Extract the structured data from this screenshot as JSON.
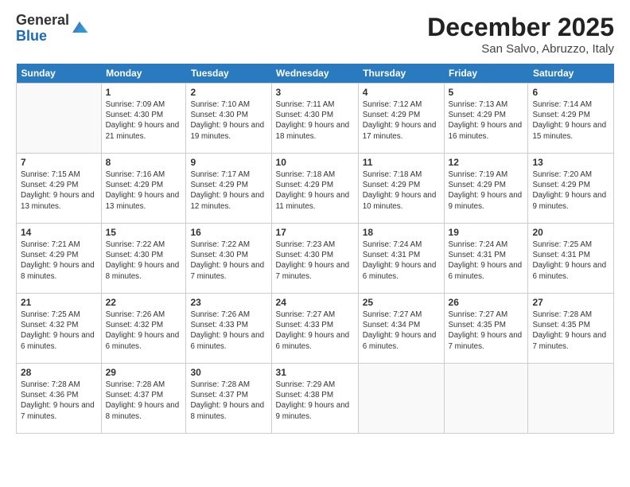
{
  "logo": {
    "line1": "General",
    "line2": "Blue"
  },
  "title": "December 2025",
  "location": "San Salvo, Abruzzo, Italy",
  "weekdays": [
    "Sunday",
    "Monday",
    "Tuesday",
    "Wednesday",
    "Thursday",
    "Friday",
    "Saturday"
  ],
  "weeks": [
    [
      {
        "day": "",
        "info": ""
      },
      {
        "day": "1",
        "info": "Sunrise: 7:09 AM\nSunset: 4:30 PM\nDaylight: 9 hours and 21 minutes."
      },
      {
        "day": "2",
        "info": "Sunrise: 7:10 AM\nSunset: 4:30 PM\nDaylight: 9 hours and 19 minutes."
      },
      {
        "day": "3",
        "info": "Sunrise: 7:11 AM\nSunset: 4:30 PM\nDaylight: 9 hours and 18 minutes."
      },
      {
        "day": "4",
        "info": "Sunrise: 7:12 AM\nSunset: 4:29 PM\nDaylight: 9 hours and 17 minutes."
      },
      {
        "day": "5",
        "info": "Sunrise: 7:13 AM\nSunset: 4:29 PM\nDaylight: 9 hours and 16 minutes."
      },
      {
        "day": "6",
        "info": "Sunrise: 7:14 AM\nSunset: 4:29 PM\nDaylight: 9 hours and 15 minutes."
      }
    ],
    [
      {
        "day": "7",
        "info": "Sunrise: 7:15 AM\nSunset: 4:29 PM\nDaylight: 9 hours and 13 minutes."
      },
      {
        "day": "8",
        "info": "Sunrise: 7:16 AM\nSunset: 4:29 PM\nDaylight: 9 hours and 13 minutes."
      },
      {
        "day": "9",
        "info": "Sunrise: 7:17 AM\nSunset: 4:29 PM\nDaylight: 9 hours and 12 minutes."
      },
      {
        "day": "10",
        "info": "Sunrise: 7:18 AM\nSunset: 4:29 PM\nDaylight: 9 hours and 11 minutes."
      },
      {
        "day": "11",
        "info": "Sunrise: 7:18 AM\nSunset: 4:29 PM\nDaylight: 9 hours and 10 minutes."
      },
      {
        "day": "12",
        "info": "Sunrise: 7:19 AM\nSunset: 4:29 PM\nDaylight: 9 hours and 9 minutes."
      },
      {
        "day": "13",
        "info": "Sunrise: 7:20 AM\nSunset: 4:29 PM\nDaylight: 9 hours and 9 minutes."
      }
    ],
    [
      {
        "day": "14",
        "info": "Sunrise: 7:21 AM\nSunset: 4:29 PM\nDaylight: 9 hours and 8 minutes."
      },
      {
        "day": "15",
        "info": "Sunrise: 7:22 AM\nSunset: 4:30 PM\nDaylight: 9 hours and 8 minutes."
      },
      {
        "day": "16",
        "info": "Sunrise: 7:22 AM\nSunset: 4:30 PM\nDaylight: 9 hours and 7 minutes."
      },
      {
        "day": "17",
        "info": "Sunrise: 7:23 AM\nSunset: 4:30 PM\nDaylight: 9 hours and 7 minutes."
      },
      {
        "day": "18",
        "info": "Sunrise: 7:24 AM\nSunset: 4:31 PM\nDaylight: 9 hours and 6 minutes."
      },
      {
        "day": "19",
        "info": "Sunrise: 7:24 AM\nSunset: 4:31 PM\nDaylight: 9 hours and 6 minutes."
      },
      {
        "day": "20",
        "info": "Sunrise: 7:25 AM\nSunset: 4:31 PM\nDaylight: 9 hours and 6 minutes."
      }
    ],
    [
      {
        "day": "21",
        "info": "Sunrise: 7:25 AM\nSunset: 4:32 PM\nDaylight: 9 hours and 6 minutes."
      },
      {
        "day": "22",
        "info": "Sunrise: 7:26 AM\nSunset: 4:32 PM\nDaylight: 9 hours and 6 minutes."
      },
      {
        "day": "23",
        "info": "Sunrise: 7:26 AM\nSunset: 4:33 PM\nDaylight: 9 hours and 6 minutes."
      },
      {
        "day": "24",
        "info": "Sunrise: 7:27 AM\nSunset: 4:33 PM\nDaylight: 9 hours and 6 minutes."
      },
      {
        "day": "25",
        "info": "Sunrise: 7:27 AM\nSunset: 4:34 PM\nDaylight: 9 hours and 6 minutes."
      },
      {
        "day": "26",
        "info": "Sunrise: 7:27 AM\nSunset: 4:35 PM\nDaylight: 9 hours and 7 minutes."
      },
      {
        "day": "27",
        "info": "Sunrise: 7:28 AM\nSunset: 4:35 PM\nDaylight: 9 hours and 7 minutes."
      }
    ],
    [
      {
        "day": "28",
        "info": "Sunrise: 7:28 AM\nSunset: 4:36 PM\nDaylight: 9 hours and 7 minutes."
      },
      {
        "day": "29",
        "info": "Sunrise: 7:28 AM\nSunset: 4:37 PM\nDaylight: 9 hours and 8 minutes."
      },
      {
        "day": "30",
        "info": "Sunrise: 7:28 AM\nSunset: 4:37 PM\nDaylight: 9 hours and 8 minutes."
      },
      {
        "day": "31",
        "info": "Sunrise: 7:29 AM\nSunset: 4:38 PM\nDaylight: 9 hours and 9 minutes."
      },
      {
        "day": "",
        "info": ""
      },
      {
        "day": "",
        "info": ""
      },
      {
        "day": "",
        "info": ""
      }
    ]
  ]
}
